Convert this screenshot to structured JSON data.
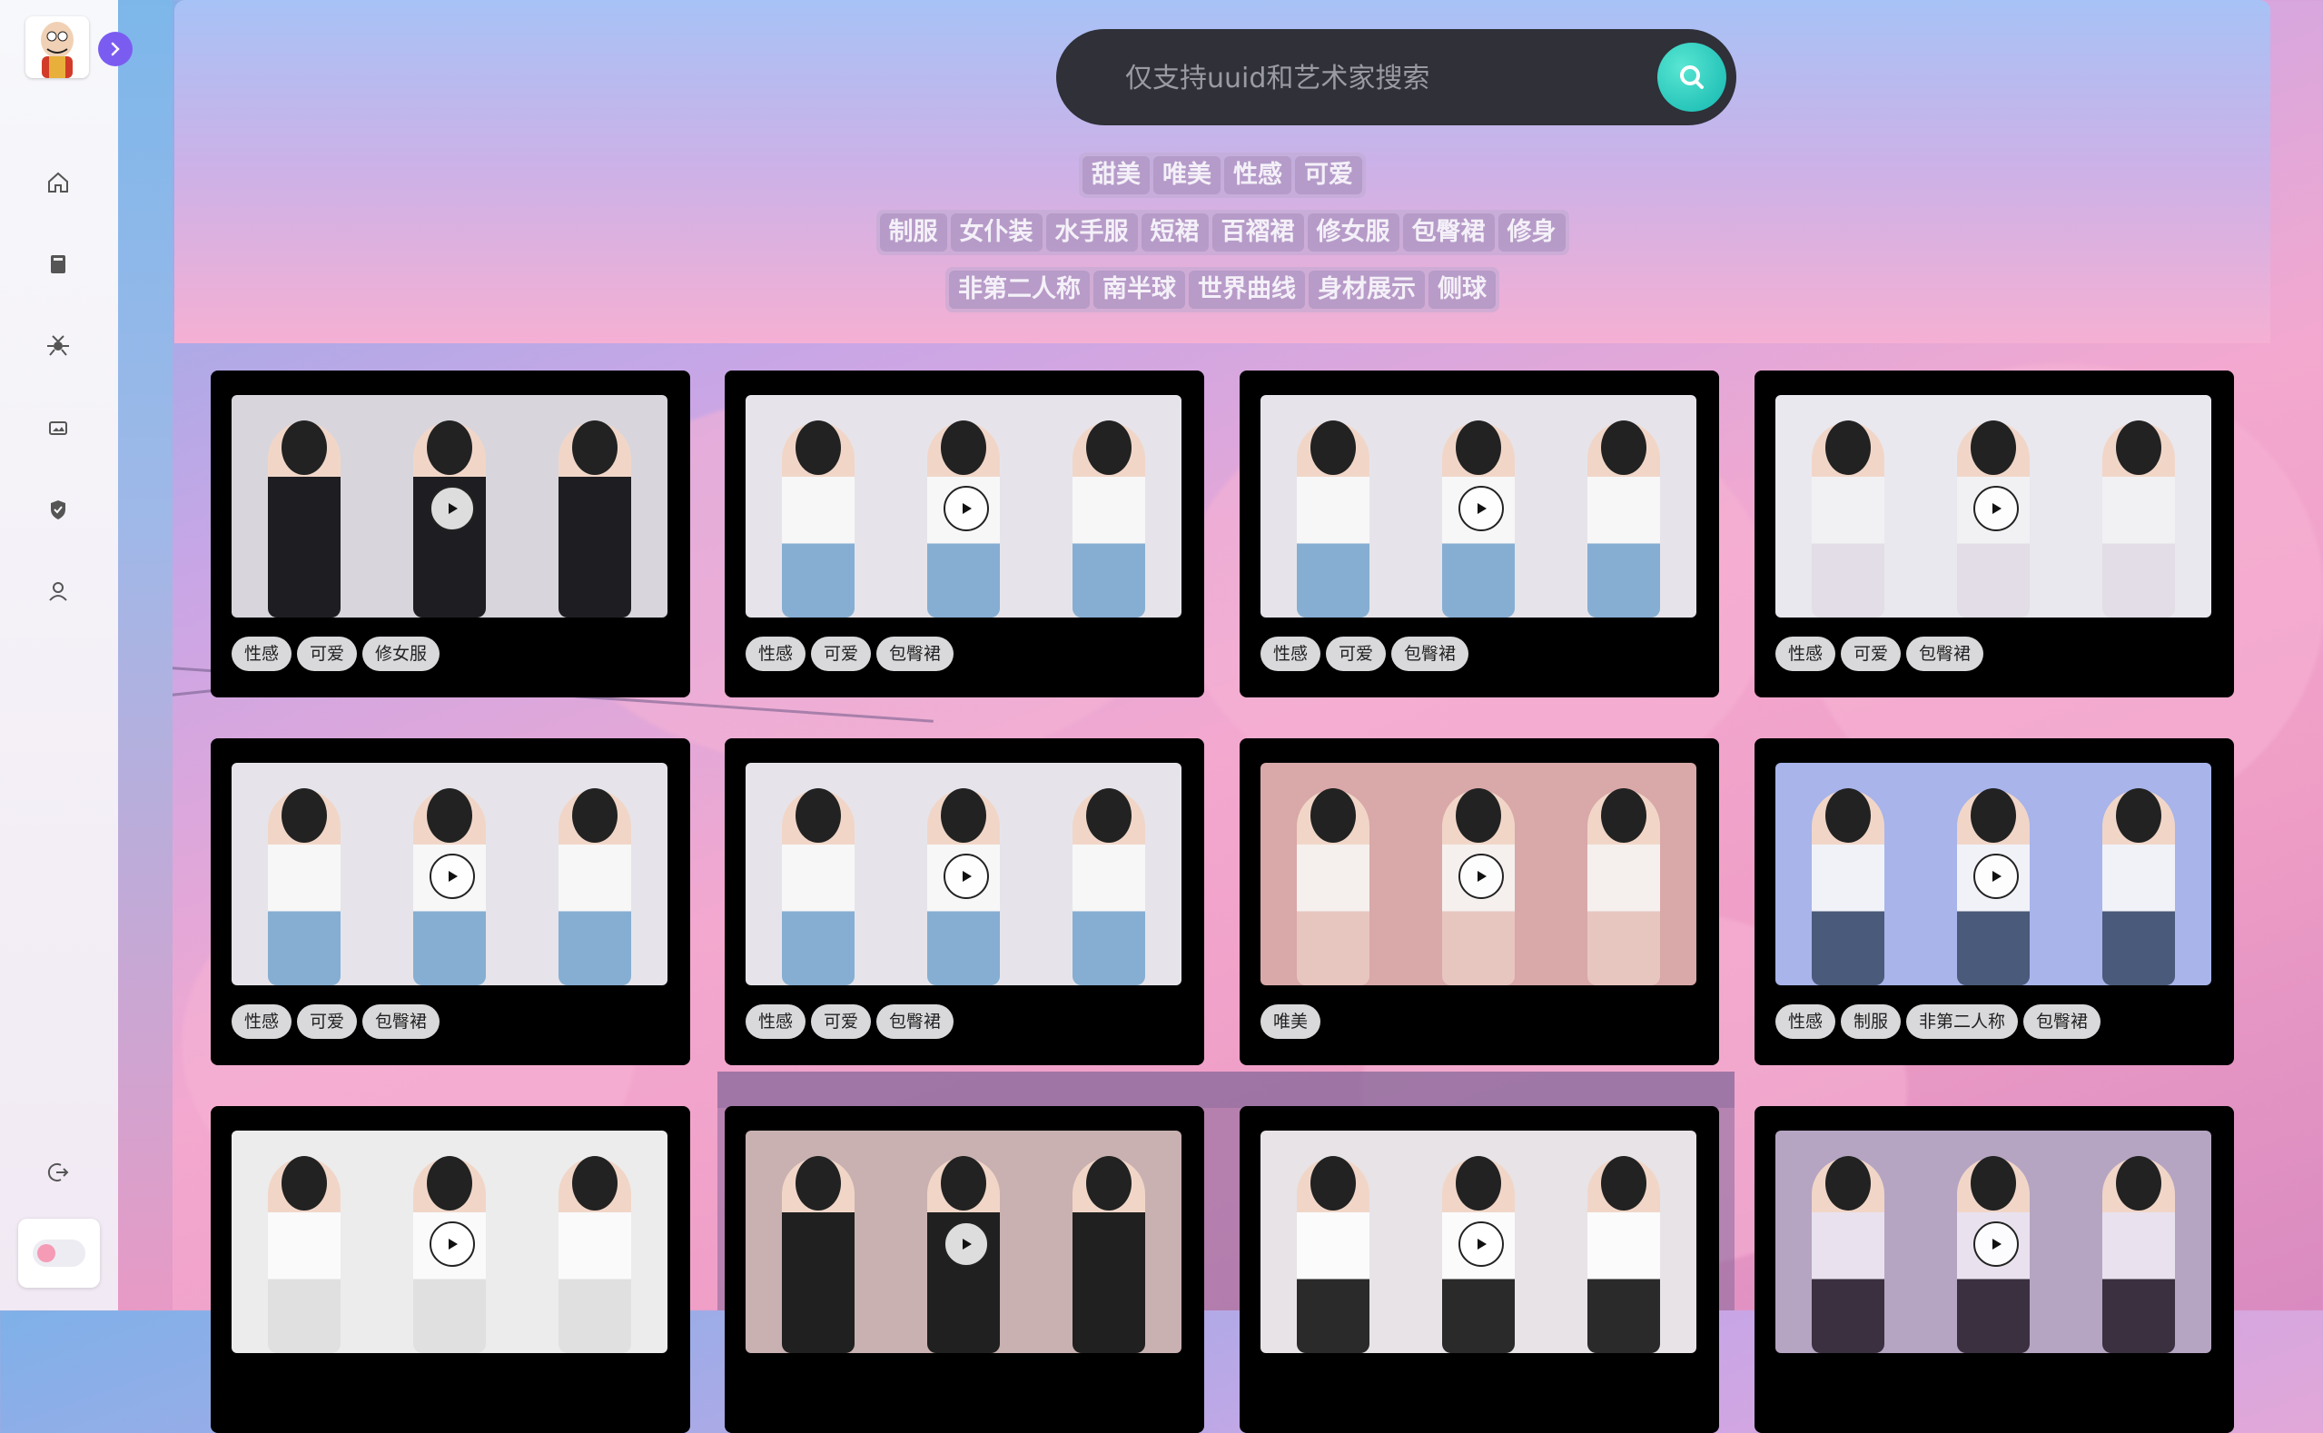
{
  "search": {
    "placeholder": "仅支持uuid和艺术家搜索"
  },
  "header_tags": {
    "row1": [
      "甜美",
      "唯美",
      "性感",
      "可爱"
    ],
    "row2": [
      "制服",
      "女仆装",
      "水手服",
      "短裙",
      "百褶裙",
      "修女服",
      "包臀裙",
      "修身"
    ],
    "row3": [
      "非第二人称",
      "南半球",
      "世界曲线",
      "身材展示",
      "侧球"
    ]
  },
  "sidebar": {
    "icons": [
      "home-icon",
      "book-icon",
      "spider-icon",
      "image-icon",
      "shield-icon",
      "user-icon"
    ],
    "bottom_icon": "logout-icon"
  },
  "cards": [
    {
      "tags": [
        "性感",
        "可爱",
        "修女服"
      ],
      "theme": "dark-dress"
    },
    {
      "tags": [
        "性感",
        "可爱",
        "包臀裙"
      ],
      "theme": "white-blue"
    },
    {
      "tags": [
        "性感",
        "可爱",
        "包臀裙"
      ],
      "theme": "white-blue"
    },
    {
      "tags": [
        "性感",
        "可爱",
        "包臀裙"
      ],
      "theme": "closeup"
    },
    {
      "tags": [
        "性感",
        "可爱",
        "包臀裙"
      ],
      "theme": "white-blue"
    },
    {
      "tags": [
        "性感",
        "可爱",
        "包臀裙"
      ],
      "theme": "white-blue"
    },
    {
      "tags": [
        "唯美"
      ],
      "theme": "pink-bg"
    },
    {
      "tags": [
        "性感",
        "制服",
        "非第二人称",
        "包臀裙"
      ],
      "theme": "stage"
    },
    {
      "tags": [],
      "theme": "white-shirt"
    },
    {
      "tags": [],
      "theme": "black-dress"
    },
    {
      "tags": [],
      "theme": "white-blouse"
    },
    {
      "tags": [],
      "theme": "stream"
    }
  ],
  "colors": {
    "accent": "#7b5cf0",
    "search_button": "#13b7b0",
    "card_bg": "#000000"
  }
}
